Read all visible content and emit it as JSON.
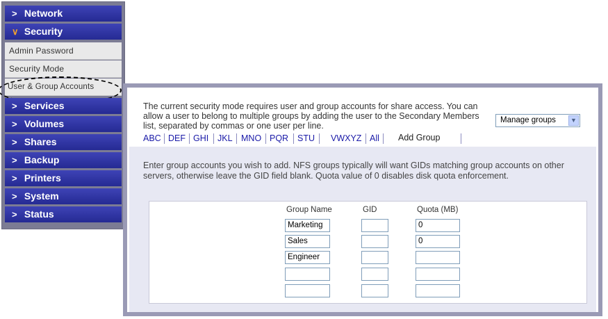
{
  "sidebar": {
    "network": "Network",
    "security": "Security",
    "security_items": [
      "Admin Password",
      "Security Mode",
      "User & Group Accounts"
    ],
    "sections": [
      "Services",
      "Volumes",
      "Shares",
      "Backup",
      "Printers",
      "System",
      "Status"
    ]
  },
  "intro_text": "The current security mode requires user and group accounts for share access. You can allow a user to belong to multiple groups by adding the user to the Secondary Members list, separated by commas or one user per line.",
  "manage_select": {
    "value": "Manage groups"
  },
  "tabs": [
    "ABC",
    "DEF",
    "GHI",
    "JKL",
    "MNO",
    "PQR",
    "STU",
    "VWXYZ",
    "All"
  ],
  "active_tab": "Add Group",
  "instructions": "Enter group accounts you wish to add. NFS groups typically will want GIDs matching group accounts on other servers, otherwise leave the GID field blank. Quota value of 0 disables disk quota enforcement.",
  "table": {
    "headers": {
      "name": "Group Name",
      "gid": "GID",
      "quota": "Quota (MB)"
    },
    "rows": [
      {
        "name": "Marketing",
        "gid": "",
        "quota": "0"
      },
      {
        "name": "Sales",
        "gid": "",
        "quota": "0"
      },
      {
        "name": "Engineer",
        "gid": "",
        "quota": ""
      },
      {
        "name": "",
        "gid": "",
        "quota": ""
      },
      {
        "name": "",
        "gid": "",
        "quota": ""
      }
    ]
  },
  "colors": {
    "nav_blue": "#2f34a4",
    "chevron_open": "#f0a030",
    "tab_link": "#1a1aa8"
  },
  "icons": {
    "collapsed": "chevron-right-icon",
    "expanded": "chevron-down-icon",
    "select_arrow": "dropdown-arrow-icon"
  }
}
